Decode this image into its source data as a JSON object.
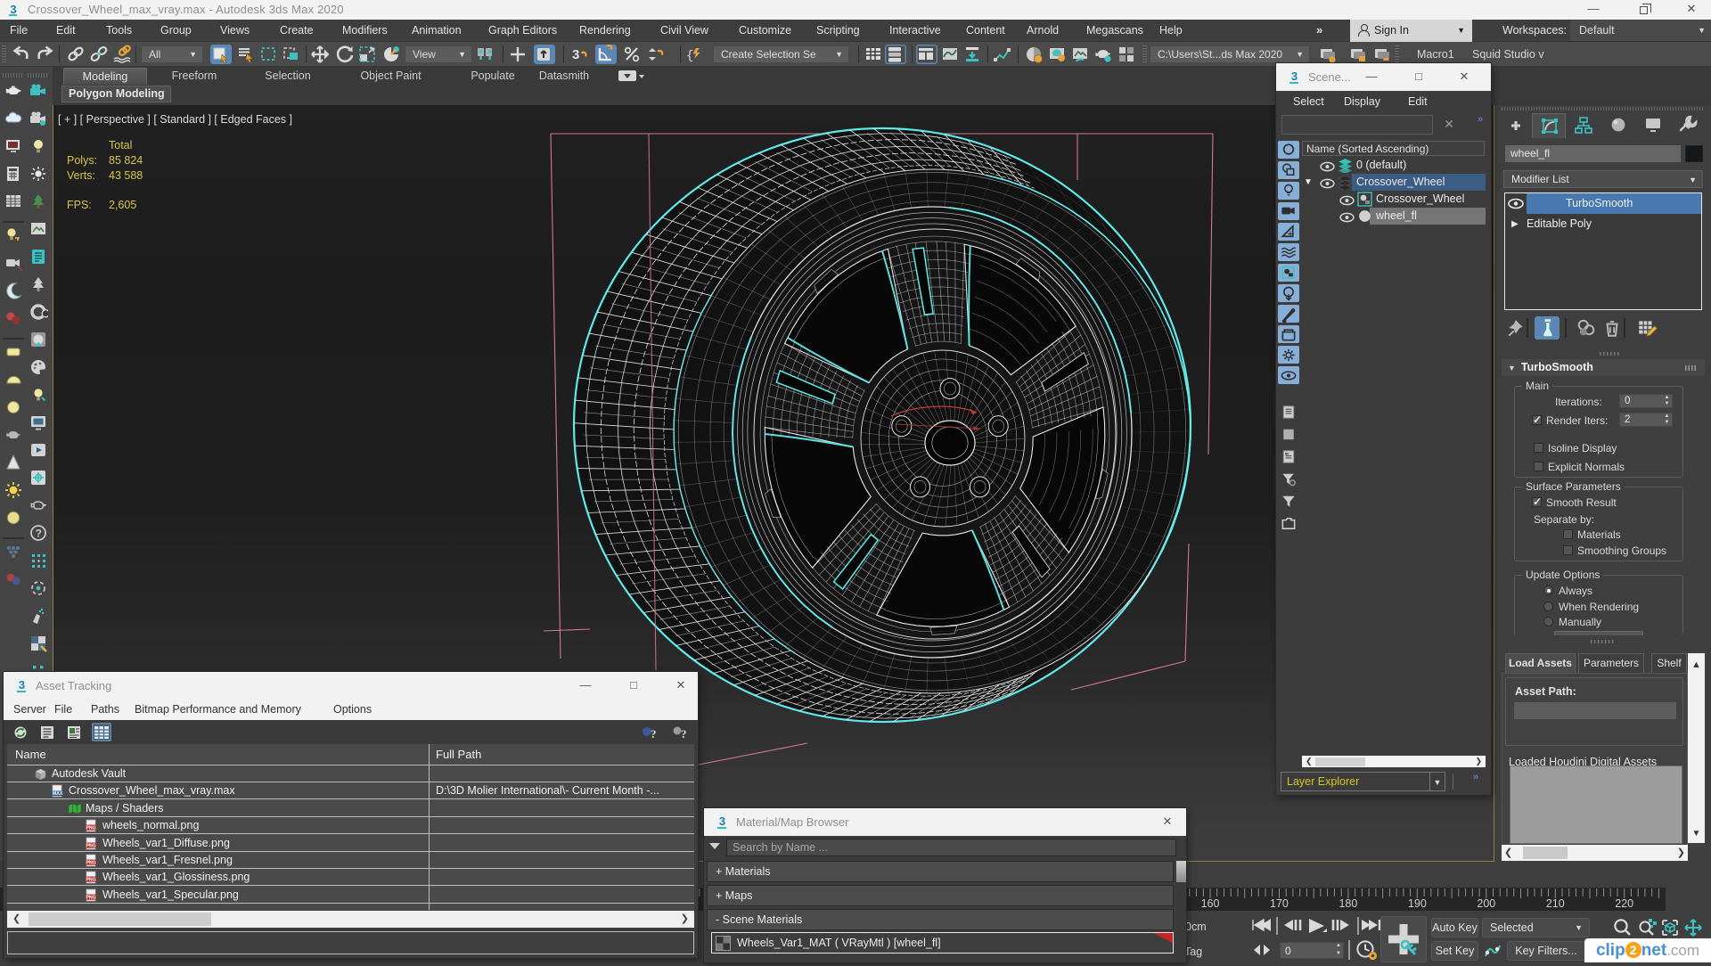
{
  "window": {
    "title": "Crossover_Wheel_max_vray.max - Autodesk 3ds Max 2020"
  },
  "menubar": {
    "items": [
      "File",
      "Edit",
      "Tools",
      "Group",
      "Views",
      "Create",
      "Modifiers",
      "Animation",
      "Graph Editors",
      "Rendering",
      "Civil View",
      "Customize",
      "Scripting",
      "Interactive",
      "Content",
      "Arnold",
      "Megascans",
      "Help"
    ],
    "overflow": "»",
    "sign_in": "Sign In",
    "workspaces_label": "Workspaces:",
    "workspace_value": "Default"
  },
  "toolbar": {
    "all_dropdown": "All",
    "view_dropdown": "View",
    "create_selection_dropdown": "Create Selection Se",
    "project_dropdown": "C:\\Users\\St...ds Max 2020",
    "macro_label": "Macro1",
    "studio_label": "Squid Studio v",
    "icons": [
      "undo",
      "redo",
      "link",
      "unlink",
      "bind",
      "select",
      "select-by-name",
      "select-region",
      "select-crossing",
      "move",
      "rotate",
      "scale",
      "manipulate",
      "manip-pair",
      "place-cross",
      "place-box",
      "snap-3d",
      "snap-angle",
      "snap-percent",
      "snap-spinner",
      "named-selections",
      "mirror",
      "align",
      "grid-table",
      "layers",
      "windows-layout",
      "curve-image",
      "schematic",
      "material-editor",
      "render-setup",
      "render-frame",
      "render-production",
      "render-grid",
      "scene-layers-1",
      "scene-layers-2",
      "scene-layers-3",
      "scene-layers-4"
    ]
  },
  "ribbon": {
    "tabs": [
      "Modeling",
      "Freeform",
      "Selection",
      "Object Paint",
      "Populate",
      "Datasmith"
    ],
    "active_tab": "Modeling",
    "panel_label": "Polygon Modeling"
  },
  "left_toolbar": {
    "column1": [
      "teapot-white",
      "cloud",
      "monitor-red",
      "calculator",
      "table",
      "sep",
      "bulb-key",
      "camera-speaker",
      "moon",
      "spheres-red",
      "sep",
      "slab-yellow",
      "dome-yellow",
      "circle-yellow",
      "teapot-gray",
      "cone-white",
      "sun",
      "sphere-yellow",
      "sep",
      "grid-spheres",
      "spheres-redblue"
    ],
    "column2": [
      "camera-teal",
      "camera-white",
      "bulb-teal",
      "sun-small",
      "tree",
      "box-image",
      "doc-teal",
      "tree-dark",
      "donut",
      "box-sphere",
      "palette",
      "bulb-small",
      "monitor-box",
      "play-box",
      "crosshair-box",
      "teapot-outline",
      "question",
      "grid-dots",
      "target",
      "spray",
      "checker-box",
      "grid-small",
      "trees-pair",
      "doc-lines",
      "question2"
    ]
  },
  "viewport": {
    "label": "[ + ] [ Perspective ] [ Standard ] [ Edged Faces ]",
    "stats": {
      "total_label": "Total",
      "polys_label": "Polys:",
      "polys_value": "85 824",
      "verts_label": "Verts:",
      "verts_value": "43 588",
      "fps_label": "FPS:",
      "fps_value": "2,605"
    }
  },
  "scene_explorer": {
    "title": "Scene...",
    "menus": [
      "Select",
      "Display",
      "Edit"
    ],
    "search_more": "»",
    "tree_header": "Name (Sorted Ascending)",
    "rows": [
      {
        "label": "0 (default)",
        "icon": "layers-teal",
        "state": "normal"
      },
      {
        "label": "Crossover_Wheel",
        "icon": "layers-dark",
        "state": "selected",
        "expander": true
      },
      {
        "label": "Crossover_Wheel",
        "icon": "geometry",
        "state": "normal",
        "child": true
      },
      {
        "label": "wheel_fl",
        "icon": "circle-gray",
        "state": "gray",
        "child": true
      }
    ],
    "strip_icons": [
      "geometry",
      "shapes",
      "lights",
      "cameras",
      "helpers",
      "spacewarps",
      "groups",
      "xrefs",
      "bone",
      "container",
      "gear",
      "eye",
      "doc1",
      "square",
      "doc2",
      "funnel-gear",
      "funnel",
      "folder"
    ],
    "footer_dropdown": "Layer Explorer",
    "footer_more": "»"
  },
  "command_panel": {
    "tabs": [
      "create",
      "modify",
      "hierarchy",
      "motion",
      "display",
      "utilities"
    ],
    "active_tab": "modify",
    "object_name": "wheel_fl",
    "modifier_list_label": "Modifier List",
    "stack": [
      {
        "label": "TurboSmooth",
        "selected": true,
        "eye": true
      },
      {
        "label": "Editable Poly",
        "selected": false,
        "expand": true
      }
    ],
    "rollout_title": "TurboSmooth",
    "main_group": {
      "label": "Main",
      "iterations_label": "Iterations:",
      "iterations_value": "0",
      "render_iters_label": "Render Iters:",
      "render_iters_value": "2",
      "render_iters_checked": true,
      "isoline_label": "Isoline Display",
      "isoline_checked": false,
      "explicit_label": "Explicit Normals",
      "explicit_checked": false
    },
    "surface_group": {
      "label": "Surface Parameters",
      "smooth_result_label": "Smooth Result",
      "smooth_result_checked": true,
      "separate_by_label": "Separate by:",
      "materials_label": "Materials",
      "materials_checked": false,
      "smoothing_groups_label": "Smoothing Groups",
      "smoothing_groups_checked": false
    },
    "update_group": {
      "label": "Update Options",
      "options": [
        "Always",
        "When Rendering",
        "Manually"
      ],
      "selected_option": "Always"
    }
  },
  "houdini_panel": {
    "tabs": [
      "Load Assets",
      "Parameters",
      "Shelf"
    ],
    "active_tab": "Load Assets",
    "asset_path_label": "Asset Path:",
    "loaded_label": "Loaded Houdini Digital Assets"
  },
  "asset_tracking": {
    "title": "Asset Tracking",
    "menus": [
      "Server",
      "File",
      "Paths",
      "Bitmap Performance and Memory",
      "Options"
    ],
    "columns": [
      "Name",
      "Full Path"
    ],
    "rows": [
      {
        "name": "Autodesk Vault",
        "path": "",
        "indent": 1,
        "icon": "vault"
      },
      {
        "name": "Crossover_Wheel_max_vray.max",
        "path": "D:\\3D Molier International\\- Current Month -...",
        "indent": 2,
        "icon": "max"
      },
      {
        "name": "Maps / Shaders",
        "path": "",
        "indent": 3,
        "icon": "maps"
      },
      {
        "name": "wheels_normal.png",
        "path": "",
        "indent": 4,
        "icon": "png"
      },
      {
        "name": "Wheels_var1_Diffuse.png",
        "path": "",
        "indent": 4,
        "icon": "png"
      },
      {
        "name": "Wheels_var1_Fresnel.png",
        "path": "",
        "indent": 4,
        "icon": "png"
      },
      {
        "name": "Wheels_var1_Glossiness.png",
        "path": "",
        "indent": 4,
        "icon": "png"
      },
      {
        "name": "Wheels_var1_Specular.png",
        "path": "",
        "indent": 4,
        "icon": "png"
      }
    ]
  },
  "material_browser": {
    "title": "Material/Map Browser",
    "search_placeholder": "Search by Name ...",
    "groups": [
      "+ Materials",
      "+ Maps",
      "- Scene Materials"
    ],
    "material_entry": "Wheels_Var1_MAT ( VRayMtl )  [wheel_fl]"
  },
  "timeline": {
    "tick_labels": [
      "160",
      "170",
      "180",
      "190",
      "200",
      "210",
      "220"
    ],
    "grid_text": "0cm",
    "tag_text": "Tag",
    "frame_value": "0",
    "auto_key_label": "Auto Key",
    "set_key_label": "Set Key",
    "selected_dropdown": "Selected",
    "key_filters_label": "Key Filters..."
  },
  "watermark": {
    "clip": "clip",
    "two": "2",
    "net": "net",
    "com": ".com"
  },
  "colors": {
    "accent_teal": "#3fc1c1",
    "selection_blue": "#4878b0",
    "row_blue": "#3a5c85",
    "stats_yellow": "#d5c54d",
    "wire_cyan": "#56e8e8",
    "cage_pink": "#e27a9f",
    "viewport_border_gold": "#8f7e3e"
  }
}
